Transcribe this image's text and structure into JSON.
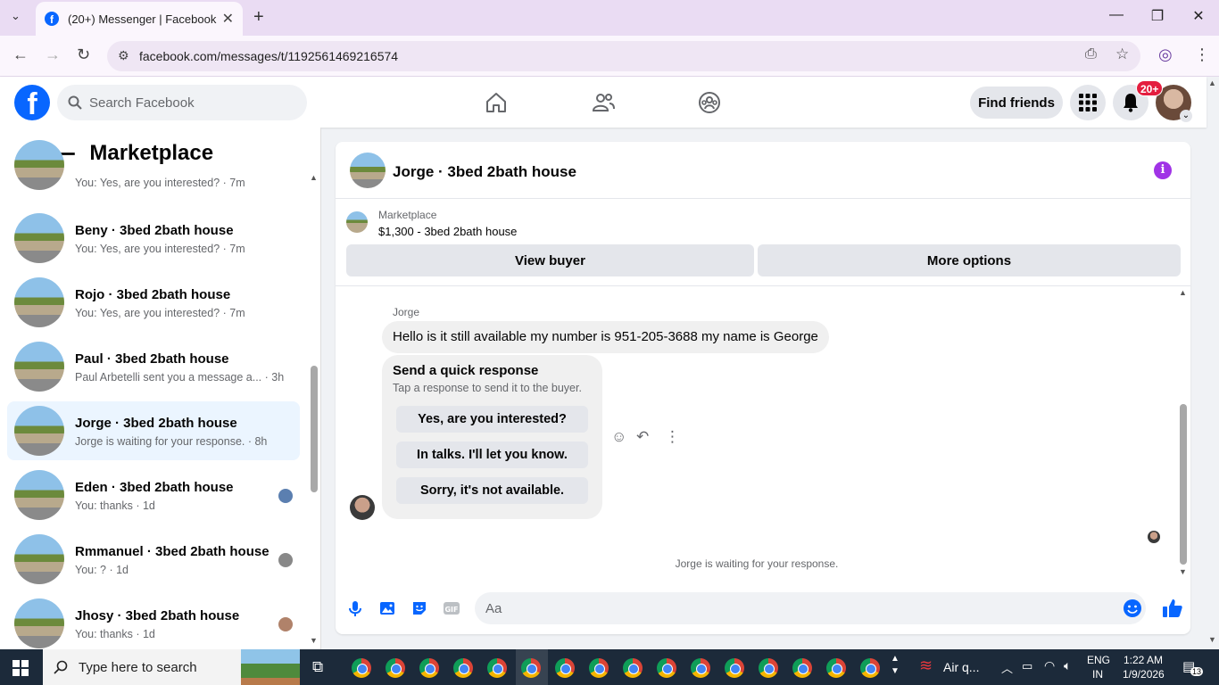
{
  "browser": {
    "tab_title": "(20+) Messenger | Facebook",
    "url": "facebook.com/messages/t/1192561469216574",
    "new_tab": "+",
    "close_tab": "✕"
  },
  "fb": {
    "search_placeholder": "Search Facebook",
    "find_friends": "Find friends",
    "notif_badge": "20+"
  },
  "sidebar": {
    "title": "Marketplace",
    "conversations": [
      {
        "name": "",
        "snippet": "You: Yes, are you interested? · 7m"
      },
      {
        "name": "Beny · 3bed 2bath house",
        "snippet": "You: Yes, are you interested? · 7m"
      },
      {
        "name": "Rojo · 3bed 2bath house",
        "snippet": "You: Yes, are you interested? · 7m"
      },
      {
        "name": "Paul · 3bed 2bath house",
        "snippet": "Paul Arbetelli sent you a message a... · 3h"
      },
      {
        "name": "Jorge · 3bed 2bath house",
        "snippet": "Jorge is waiting for your response. · 8h",
        "active": true
      },
      {
        "name": "Eden · 3bed 2bath house",
        "snippet": "You: thanks · 1d"
      },
      {
        "name": "Rmmanuel · 3bed 2bath house",
        "snippet": "You: ? · 1d"
      },
      {
        "name": "Jhosy · 3bed 2bath house",
        "snippet": "You: thanks · 1d"
      }
    ]
  },
  "chat": {
    "title": "Jorge · 3bed 2bath house",
    "marketplace_label": "Marketplace",
    "listing": "$1,300 - 3bed 2bath house",
    "view_buyer": "View buyer",
    "more_options": "More options",
    "sender": "Jorge",
    "message": "Hello is it still available my number is 951-205-3688 my name is George",
    "quick_title": "Send a quick response",
    "quick_sub": "Tap a response to send it to the buyer.",
    "quick_responses": [
      "Yes, are you interested?",
      "In talks. I'll let you know.",
      "Sorry, it's not available."
    ],
    "waiting": "Jorge is waiting for your response.",
    "input_placeholder": "Aa"
  },
  "taskbar": {
    "search_placeholder": "Type here to search",
    "weather": "Air q...",
    "lang": "ENG",
    "region": "IN",
    "time": "1:22 AM",
    "date": "1/9/2026",
    "notif_count": "13"
  },
  "colors": {
    "fb_blue": "#0866ff",
    "messenger_purple": "#a033e6",
    "active_row": "#ebf5ff",
    "badge_red": "#e41e3f"
  }
}
